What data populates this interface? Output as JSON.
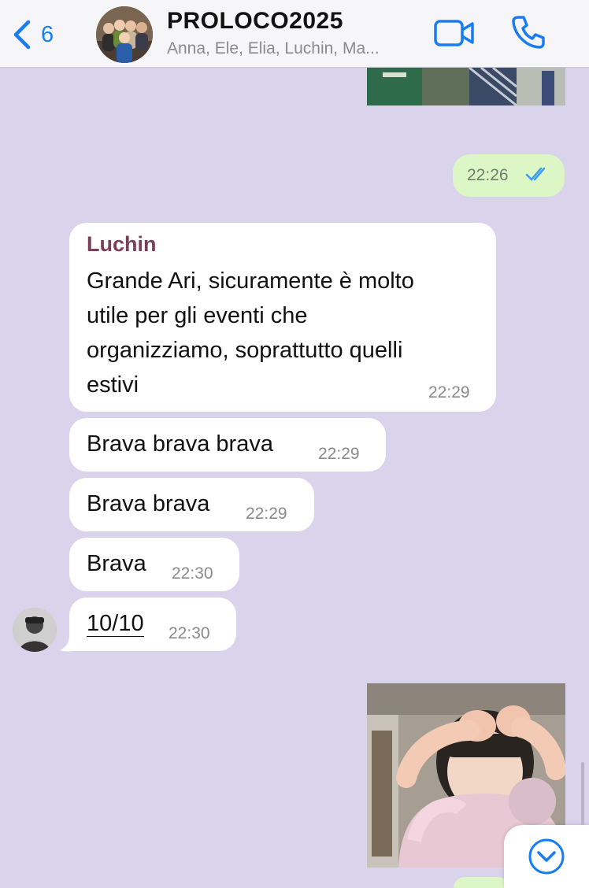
{
  "header": {
    "back_count": "6",
    "title": "PROLOCO2025",
    "subtitle": "Anna, Ele, Elia, Luchin, Ma..."
  },
  "messages": {
    "out_time_1": "22:26",
    "luchin_sender": "Luchin",
    "luchin_text": [
      "Grande Ari, sicuramente è molto",
      "utile per gli eventi che",
      "organizziamo, soprattutto quelli",
      "estivi"
    ],
    "luchin_time": "22:29",
    "m2_text": "Brava brava brava",
    "m2_time": "22:29",
    "m3_text": "Brava brava",
    "m3_time": "22:29",
    "m4_text": "Brava",
    "m4_time": "22:30",
    "m5_text": "10/10",
    "m5_time": "22:30"
  },
  "colors": {
    "chat_background": "#d9d3ec",
    "outgoing_bubble": "#dcf7c5",
    "incoming_bubble": "#ffffff",
    "accent_blue": "#1a7cf2",
    "sender_name": "#7a3e5a"
  }
}
